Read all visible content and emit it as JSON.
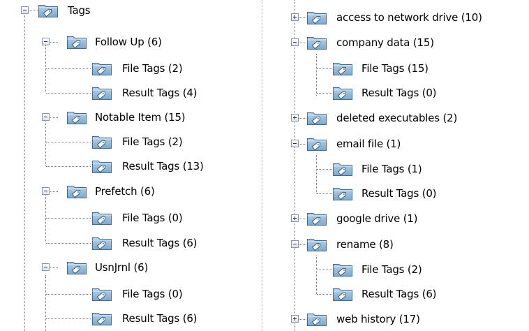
{
  "left_tree": {
    "root": {
      "label": "Tags",
      "icon": "tag-folder-icon",
      "state": "expanded"
    },
    "children": [
      {
        "label": "Follow Up (6)",
        "state": "expanded",
        "children": [
          {
            "label": "File Tags (2)"
          },
          {
            "label": "Result Tags (4)"
          }
        ]
      },
      {
        "label": "Notable Item (15)",
        "state": "expanded",
        "children": [
          {
            "label": "File Tags (2)"
          },
          {
            "label": "Result Tags (13)"
          }
        ]
      },
      {
        "label": "Prefetch (6)",
        "state": "expanded",
        "children": [
          {
            "label": "File Tags (0)"
          },
          {
            "label": "Result Tags (6)"
          }
        ]
      },
      {
        "label": "UsnJrnl (6)",
        "state": "expanded",
        "children": [
          {
            "label": "File Tags (0)"
          },
          {
            "label": "Result Tags (6)"
          }
        ]
      }
    ]
  },
  "right_tree": {
    "items": [
      {
        "label": "access to network drive (10)",
        "state": "collapsed"
      },
      {
        "label": "company data (15)",
        "state": "expanded",
        "children": [
          {
            "label": "File Tags (15)"
          },
          {
            "label": "Result Tags (0)"
          }
        ]
      },
      {
        "label": "deleted executables (2)",
        "state": "collapsed"
      },
      {
        "label": "email file (1)",
        "state": "expanded",
        "children": [
          {
            "label": "File Tags (1)"
          },
          {
            "label": "Result Tags (0)"
          }
        ]
      },
      {
        "label": "google drive (1)",
        "state": "collapsed"
      },
      {
        "label": "rename (8)",
        "state": "expanded",
        "children": [
          {
            "label": "File Tags (2)"
          },
          {
            "label": "Result Tags (6)"
          }
        ]
      },
      {
        "label": "web history (17)",
        "state": "collapsed"
      }
    ]
  },
  "colors": {
    "folder_fill": "#93b7d6",
    "folder_border": "#3f6c95",
    "tag_glyph": "#ffffff",
    "tree_lines": "#7a7a7a",
    "divider": "#a0a0a0"
  }
}
